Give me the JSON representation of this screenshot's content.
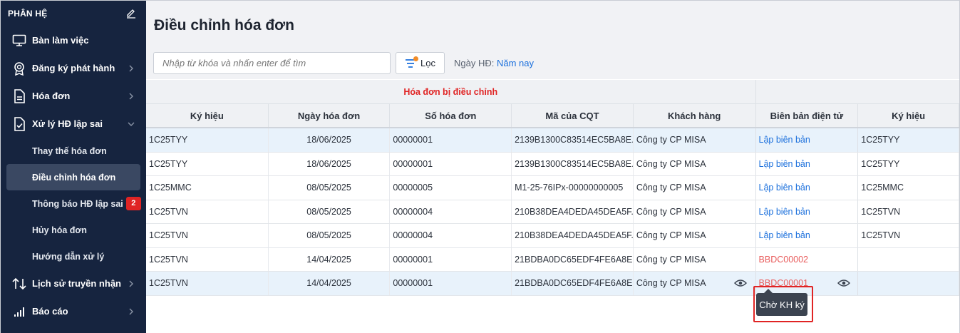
{
  "sidebar": {
    "header": "PHÂN HỆ",
    "menu": [
      {
        "label": "Bàn làm việc"
      },
      {
        "label": "Đăng ký phát hành"
      },
      {
        "label": "Hóa đơn"
      },
      {
        "label": "Xử lý HĐ lập sai"
      }
    ],
    "submenu": [
      {
        "label": "Thay thế hóa đơn"
      },
      {
        "label": "Điều chỉnh hóa đơn"
      },
      {
        "label": "Thông báo HĐ lập sai",
        "badge": "2"
      },
      {
        "label": "Hủy hóa đơn"
      },
      {
        "label": "Hướng dẫn xử lý"
      }
    ],
    "bottom": [
      {
        "label": "Lịch sử truyền nhận"
      },
      {
        "label": "Báo cáo"
      }
    ]
  },
  "main": {
    "title": "Điều chỉnh hóa đơn",
    "search_placeholder": "Nhập từ khóa và nhấn enter để tìm",
    "filter_label": "Lọc",
    "date_label": "Ngày HĐ:",
    "date_value": "Năm nay"
  },
  "table": {
    "group_header": "Hóa đơn bị điều chỉnh",
    "columns": [
      "Ký hiệu",
      "Ngày hóa đơn",
      "Số hóa đơn",
      "Mã của CQT",
      "Khách hàng",
      "Biên bản điện tử",
      "Ký hiệu"
    ],
    "rows": [
      {
        "kyhieu": "1C25TYY",
        "ngay": "18/06/2025",
        "so": "00000001",
        "ma": "2139B1300C83514EC5BA8E...",
        "kh": "Công ty CP MISA",
        "bb": "Lập biên bản",
        "kyhieu2": "1C25TYY"
      },
      {
        "kyhieu": "1C25TYY",
        "ngay": "18/06/2025",
        "so": "00000001",
        "ma": "2139B1300C83514EC5BA8E...",
        "kh": "Công ty CP MISA",
        "bb": "Lập biên bản",
        "kyhieu2": "1C25TYY"
      },
      {
        "kyhieu": "1C25MMC",
        "ngay": "08/05/2025",
        "so": "00000005",
        "ma": "M1-25-76IPx-00000000005",
        "kh": "Công ty CP MISA",
        "bb": "Lập biên bản",
        "kyhieu2": "1C25MMC"
      },
      {
        "kyhieu": "1C25TVN",
        "ngay": "08/05/2025",
        "so": "00000004",
        "ma": "210B38DEA4DEDA45DEA5F...",
        "kh": "Công ty CP MISA",
        "bb": "Lập biên bản",
        "kyhieu2": "1C25TVN"
      },
      {
        "kyhieu": "1C25TVN",
        "ngay": "08/05/2025",
        "so": "00000004",
        "ma": "210B38DEA4DEDA45DEA5F...",
        "kh": "Công ty CP MISA",
        "bb": "Lập biên bản",
        "kyhieu2": "1C25TVN"
      },
      {
        "kyhieu": "1C25TVN",
        "ngay": "14/04/2025",
        "so": "00000001",
        "ma": "21BDBA0DC65EDF4FE6A8E...",
        "kh": "Công ty CP MISA",
        "bb": "BBDC00002",
        "kyhieu2": ""
      },
      {
        "kyhieu": "1C25TVN",
        "ngay": "14/04/2025",
        "so": "00000001",
        "ma": "21BDBA0DC65EDF4FE6A8E...",
        "kh": "Công ty CP MISA",
        "bb": "BBDC00001",
        "kyhieu2": ""
      }
    ]
  },
  "tooltip": {
    "text": "Chờ KH ký"
  },
  "colors": {
    "sidebar_bg": "#16243f",
    "accent_red": "#e02424",
    "link_blue": "#1a6fdc",
    "highlight_row": "#e8f2fb"
  }
}
